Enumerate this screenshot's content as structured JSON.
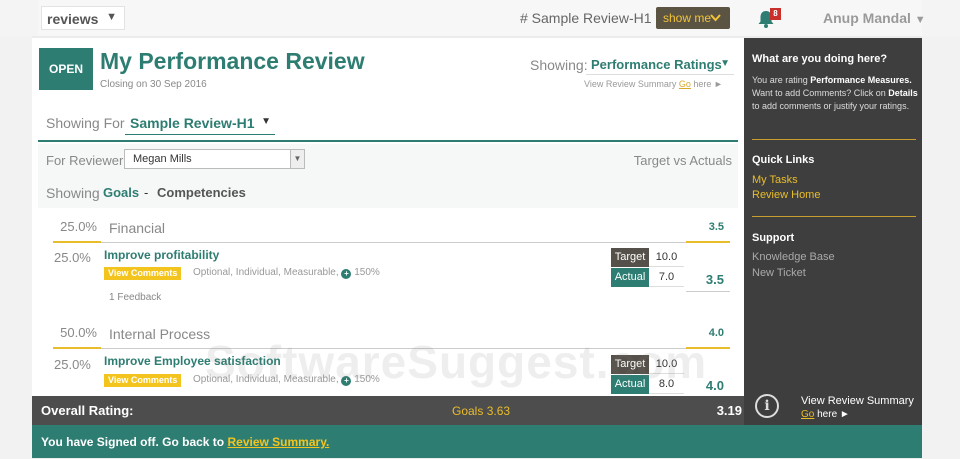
{
  "topbar": {
    "module": "reviews",
    "breadcrumb": "# Sample Review-H1",
    "show_me": "show me",
    "notifications": "8",
    "user": "Anup Mandal",
    "user_caret": "▼"
  },
  "header": {
    "status": "OPEN",
    "title": "My Performance Review",
    "closing": "Closing on 30 Sep 2016",
    "showing_label": "Showing:",
    "showing_value": "Performance Ratings",
    "summary_prefix": "View Review Summary",
    "summary_go": "Go",
    "summary_suffix": "here ►"
  },
  "filters": {
    "showing_for_label": "Showing For",
    "showing_for_value": "Sample Review-H1",
    "reviewer_label": "For Reviewer",
    "reviewer_value": "Megan Mills",
    "target_vs_actuals": "Target vs Actuals",
    "showing_label": "Showing",
    "tab_goals": "Goals",
    "tab_sep": "-",
    "tab_competencies": "Competencies"
  },
  "sections": [
    {
      "weight": "25.0%",
      "name": "Financial",
      "score": "3.5",
      "goal": {
        "weight": "25.0%",
        "title": "Improve profitability",
        "view_comments": "View Comments",
        "meta": "Optional, Individual, Measurable,",
        "meta_pct": "150%",
        "feedback": "1 Feedback",
        "target_label": "Target",
        "target": "10.0",
        "actual_label": "Actual",
        "actual": "7.0",
        "score": "3.5"
      }
    },
    {
      "weight": "50.0%",
      "name": "Internal Process",
      "score": "4.0",
      "goal": {
        "weight": "25.0%",
        "title": "Improve Employee satisfaction",
        "view_comments": "View Comments",
        "meta": "Optional, Individual, Measurable,",
        "meta_pct": "150%",
        "target_label": "Target",
        "target": "10.0",
        "actual_label": "Actual",
        "actual": "8.0",
        "score": "4.0"
      }
    }
  ],
  "overall": {
    "label": "Overall Rating:",
    "goals_label": "Goals",
    "goals_value": "3.63",
    "score": "3.19"
  },
  "signoff": {
    "message": "You have Signed off. Go back to",
    "link": "Review Summary."
  },
  "sidebar": {
    "help_title": "What are you doing here?",
    "help_text_1": "You are rating",
    "help_bold_1": "Performance Measures.",
    "help_text_2": "Want to add Comments? Click on",
    "help_bold_2": "Details",
    "help_text_3": "to add comments or justify your ratings.",
    "quick_links_title": "Quick Links",
    "quick_links": [
      "My Tasks",
      "Review Home"
    ],
    "support_title": "Support",
    "support_links": [
      "Knowledge Base",
      "New Ticket"
    ],
    "summary_label": "View Review Summary",
    "summary_go": "Go",
    "summary_suffix": "here ►"
  },
  "watermark": "SoftwareSuggest.com",
  "colors": {
    "brand_teal": "#2e7d72",
    "accent_gold": "#f4c41e",
    "sidebar_bg": "#3e3e3e",
    "overall_bg": "#4d4d4d"
  }
}
